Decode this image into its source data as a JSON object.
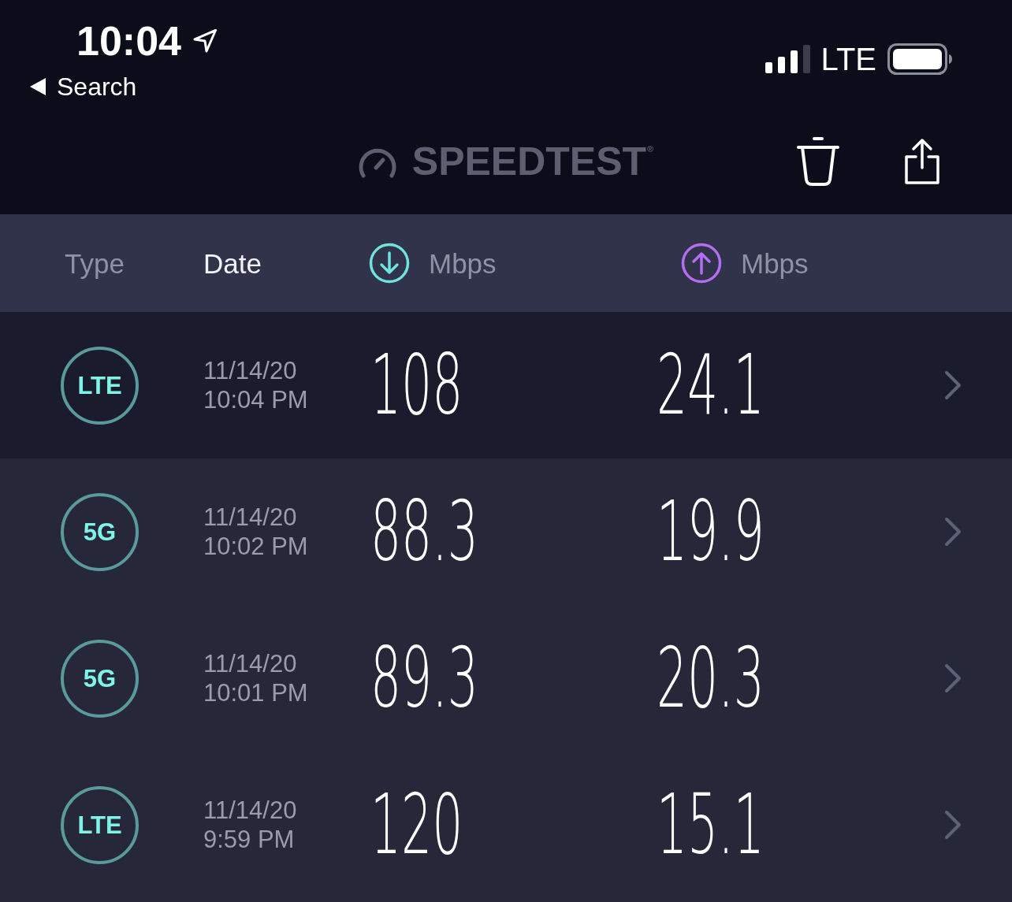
{
  "status_bar": {
    "time": "10:04",
    "back_label": "Search",
    "network": "LTE"
  },
  "nav_bar": {
    "title": "SPEEDTEST$^{®}$"
  },
  "table": {
    "columns": [
      {
        "kind": "text",
        "label": "Type",
        "selected": false
      },
      {
        "kind": "text",
        "label": "Date",
        "selected": true
      },
      {
        "kind": "download",
        "label": "Mbps",
        "selected": false
      },
      {
        "kind": "upload",
        "label": "Mbps",
        "selected": false
      }
    ],
    "rows": [
      {
        "type": "LTE",
        "date": "11/14/20",
        "time": "10:04 PM",
        "download": "108",
        "upload": "24.1",
        "selected": true
      },
      {
        "type": "5G",
        "date": "11/14/20",
        "time": "10:02 PM",
        "download": "88.3",
        "upload": "19.9",
        "selected": false
      },
      {
        "type": "5G",
        "date": "11/14/20",
        "time": "10:01 PM",
        "download": "89.3",
        "upload": "20.3",
        "selected": false
      },
      {
        "type": "LTE",
        "date": "11/14/20",
        "time": "9:59 PM",
        "download": "120",
        "upload": "15.1",
        "selected": false
      }
    ]
  }
}
